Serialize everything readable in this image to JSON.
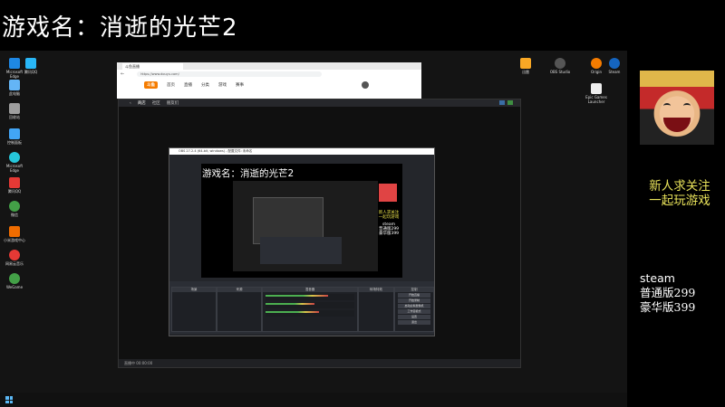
{
  "overlay": {
    "title": "游戏名：消逝的光芒2",
    "follow_line1": "新人求关注",
    "follow_line2": "一起玩游戏",
    "steam_label": "steam",
    "price_normal": "普通版299",
    "price_deluxe": "豪华版399"
  },
  "desktop": {
    "left_icons": [
      {
        "label": "Microsoft Edge",
        "color": "#1e88e5"
      },
      {
        "label": "腾讯QQ",
        "color": "#29b6f6"
      },
      {
        "label": "此电脑",
        "color": "#64b5f6"
      },
      {
        "label": "回收站",
        "color": "#9e9e9e"
      },
      {
        "label": "控制面板",
        "color": "#42a5f5"
      },
      {
        "label": "Microsoft Edge",
        "color": "#26c6da"
      },
      {
        "label": "腾讯QQ",
        "color": "#e53935"
      },
      {
        "label": "微信",
        "color": "#43a047"
      },
      {
        "label": "小米游戏中心",
        "color": "#ef6c00"
      },
      {
        "label": "网易云音乐",
        "color": "#e53935"
      },
      {
        "label": "WeGame",
        "color": "#43a047"
      }
    ],
    "right_icons": [
      {
        "label": "OBS Studio",
        "color": "#555555"
      },
      {
        "label": "Origin",
        "color": "#f57c00"
      },
      {
        "label": "Steam",
        "color": "#1565c0"
      },
      {
        "label": "Epic Games Launcher",
        "color": "#eeeeee"
      },
      {
        "label": "迅雷",
        "color": "#42a5f5"
      }
    ]
  },
  "browser": {
    "tab_label": "斗鱼直播",
    "url": "https://www.douyu.com/",
    "logo": "斗鱼",
    "nav": [
      "首页",
      "直播",
      "分类",
      "游戏",
      "赛事"
    ]
  },
  "obs": {
    "top_tabs": [
      "商店",
      "社区",
      "朋友们"
    ],
    "footer_text": "直播中 00:00:00"
  },
  "nested": {
    "titlebar": "OBS 27.2.4 (64-bit, windows) - 配置文件: 未命名",
    "preview_title": "游戏名：消逝的光芒2",
    "yellow1": "新人求关注",
    "yellow2": "一起玩游戏",
    "white1": "steam",
    "white2": "普通版299",
    "white3": "豪华版399",
    "panels": [
      "场景",
      "来源",
      "混音器",
      "转场特效",
      "控制"
    ],
    "controls": [
      "开始直播",
      "开始录制",
      "启动虚拟摄像机",
      "工作室模式",
      "设置",
      "退出"
    ]
  }
}
